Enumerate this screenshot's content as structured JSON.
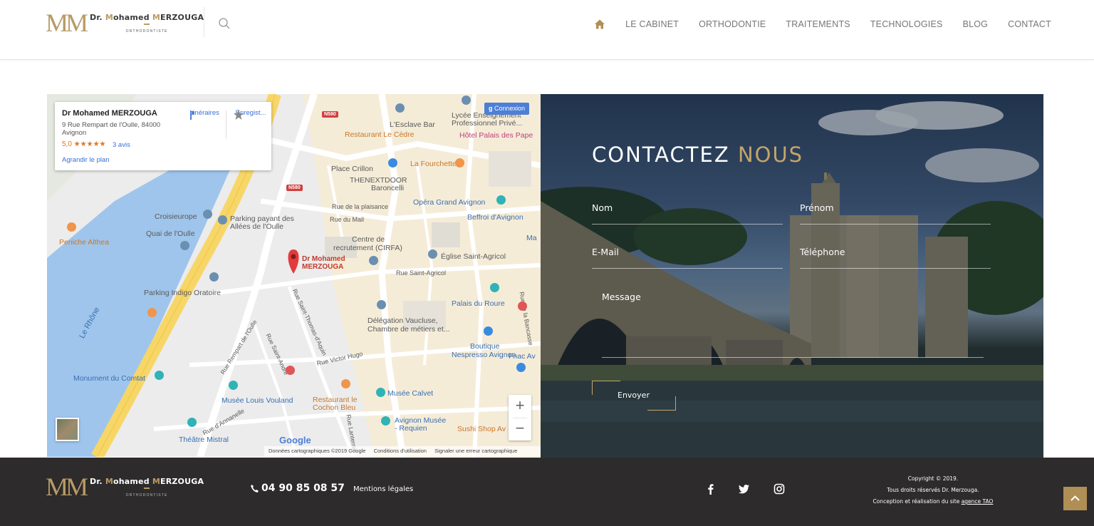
{
  "brand": {
    "name_prefix": "Dr. ",
    "name_m1": "M",
    "name_mid": "ohamed ",
    "name_m2": "M",
    "name_suffix": "ERZOUGA",
    "monogram": "MM",
    "subtitle": "ORTHODONTISTE",
    "gold": "#b89b67"
  },
  "nav": {
    "items": [
      "LE CABINET",
      "ORTHODONTIE",
      "TRAITEMENTS",
      "TECHNOLOGIES",
      "BLOG",
      "CONTACT"
    ]
  },
  "map": {
    "card": {
      "title": "Dr Mohamed MERZOUGA",
      "address": "9 Rue Rempart de l'Oulle, 84000 Avignon",
      "rating": "5,0 ★★★★★",
      "reviews": "3 avis",
      "enlarge": "Agrandir le plan",
      "directions": "Itinéraires",
      "save": "Enregist..."
    },
    "connexion": "Connexion",
    "google": "Google",
    "footer": [
      "Données cartographiques ©2019 Google",
      "Conditions d'utilisation",
      "Signaler une erreur cartographique"
    ],
    "pin_label_1": "Dr Mohamed",
    "pin_label_2": "MERZOUGA",
    "shields": [
      "N580",
      "N580"
    ],
    "labels": [
      {
        "t": "Lycée Enseignement",
        "c": "dark"
      },
      {
        "t": "Professionnel Privé...",
        "c": "dark"
      },
      {
        "t": "L'Esclave Bar",
        "c": "dark"
      },
      {
        "t": "Restaurant Le Cèdre",
        "c": "orange"
      },
      {
        "t": "Hôtel Palais des Pape",
        "c": "pink"
      },
      {
        "t": "La Fourchette",
        "c": "orange"
      },
      {
        "t": "Place Crillon",
        "c": "dark"
      },
      {
        "t": "THENEXTDOOR",
        "c": "dark"
      },
      {
        "t": "Baroncelli",
        "c": "dark"
      },
      {
        "t": "Opéra Grand Avignon",
        "c": "blue"
      },
      {
        "t": "Beffroi d'Avignon",
        "c": "blue"
      },
      {
        "t": "Croisieurope",
        "c": "dark"
      },
      {
        "t": "Parking payant des",
        "c": "dark"
      },
      {
        "t": "Allées de l'Oulle",
        "c": "dark"
      },
      {
        "t": "Quai de l'Oulle",
        "c": "dark"
      },
      {
        "t": "Peniche Althea",
        "c": "orange"
      },
      {
        "t": "Rue de la plaisance",
        "c": "dark"
      },
      {
        "t": "Rue du Mail",
        "c": "dark"
      },
      {
        "t": "Centre de",
        "c": "dark"
      },
      {
        "t": "recrutement (CIRFA)",
        "c": "dark"
      },
      {
        "t": "Église Saint-Agricol",
        "c": "dark"
      },
      {
        "t": "Rue Saint-Agricol",
        "c": "dark"
      },
      {
        "t": "Parking Indigo Oratoire",
        "c": "dark"
      },
      {
        "t": "Palais du Roure",
        "c": "blue"
      },
      {
        "t": "Délégation Vaucluse,",
        "c": "dark"
      },
      {
        "t": "Chambre de métiers et...",
        "c": "dark"
      },
      {
        "t": "Boutique",
        "c": "blue"
      },
      {
        "t": "Nespresso Avignon",
        "c": "blue"
      },
      {
        "t": "Fnac Av",
        "c": "blue"
      },
      {
        "t": "Le Rhône",
        "c": "blue"
      },
      {
        "t": "Monument du Comtat",
        "c": "blue"
      },
      {
        "t": "Musée Calvet",
        "c": "blue"
      },
      {
        "t": "Musée Louis Vouland",
        "c": "blue"
      },
      {
        "t": "Restaurant le",
        "c": "orange"
      },
      {
        "t": "Cochon Bleu",
        "c": "orange"
      },
      {
        "t": "Avignon Musée",
        "c": "blue"
      },
      {
        "t": "- Requien",
        "c": "blue"
      },
      {
        "t": "Sushi Shop Av",
        "c": "orange"
      },
      {
        "t": "Théâtre Mistral",
        "c": "blue"
      },
      {
        "t": "Rue Victor Hugo",
        "c": "dark"
      },
      {
        "t": "Rue d'Annanelle",
        "c": "dark"
      },
      {
        "t": "Rue Saint-Thomas-d'Aquin",
        "c": "dark"
      },
      {
        "t": "Rue Rempart de l'Oulle",
        "c": "dark"
      },
      {
        "t": "Rue Saint-André",
        "c": "dark"
      },
      {
        "t": "Rue de la Bancasse",
        "c": "dark"
      },
      {
        "t": "Rue Lanterne",
        "c": "dark"
      },
      {
        "t": "Ma",
        "c": "blue"
      }
    ]
  },
  "contact": {
    "title_white": "CONTACTEZ ",
    "title_gold": "NOUS",
    "fields": {
      "nom": "Nom",
      "prenom": "Prénom",
      "email": "E-Mail",
      "telephone": "Téléphone",
      "message": "Message"
    },
    "send": "Envoyer",
    "accent": "#c6a46a"
  },
  "footer": {
    "phone": "04 90 85 08 57",
    "legal": "Mentions légales",
    "copy_1": "Copyright © 2019.",
    "copy_2": "Tous droits réservés Dr. Merzouga.",
    "copy_3_pre": "Conception et réalisation du site ",
    "copy_3_link": "agence TAO",
    "social": [
      "facebook-icon",
      "twitter-icon",
      "instagram-icon"
    ],
    "scroll_top_color": "#b08f55"
  }
}
